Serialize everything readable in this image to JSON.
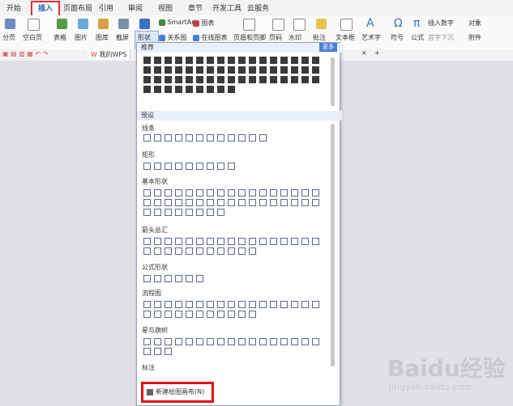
{
  "tabs": [
    "开始",
    "插入",
    "页面布局",
    "引用",
    "审阅",
    "视图",
    "章节",
    "开发工具",
    "云服务"
  ],
  "active_tab": "插入",
  "ribbon": {
    "pagebreak": "分页",
    "blankpage": "空白页",
    "table": "表格",
    "picture": "图片",
    "gallery": "图库",
    "screenshot": "截屏",
    "shapes": "形状",
    "smartart": "SmartArt",
    "chart": "图表",
    "relation": "关系图",
    "online_chart": "在线图表",
    "header_footer": "页眉和页脚",
    "page_num": "页码",
    "watermark": "水印",
    "comment": "批注",
    "textbox": "文本框",
    "wordart": "艺术字",
    "symbol": "符号",
    "formula": "公式",
    "insert_number": "插入数字",
    "object": "对象",
    "attachment": "附件",
    "first_letter": "首字下沉"
  },
  "quick_access": {
    "doc_tab": "我的WPS",
    "plus": "+",
    "close": "×"
  },
  "panel": {
    "recommended": "推荐",
    "more": "更多",
    "preset": "预设",
    "categories": [
      "线条",
      "矩形",
      "基本形状",
      "箭头总汇",
      "公式形状",
      "流程图",
      "星与旗帜",
      "标注"
    ],
    "new_canvas": "新建绘图画布(N)"
  },
  "watermark": {
    "brand": "Baidu经验",
    "site": "jingyan.baidu.com"
  },
  "colors": {
    "accent": "#e0302f",
    "highlight": "#4a7fd8",
    "workspace": "#dfe1e6"
  }
}
